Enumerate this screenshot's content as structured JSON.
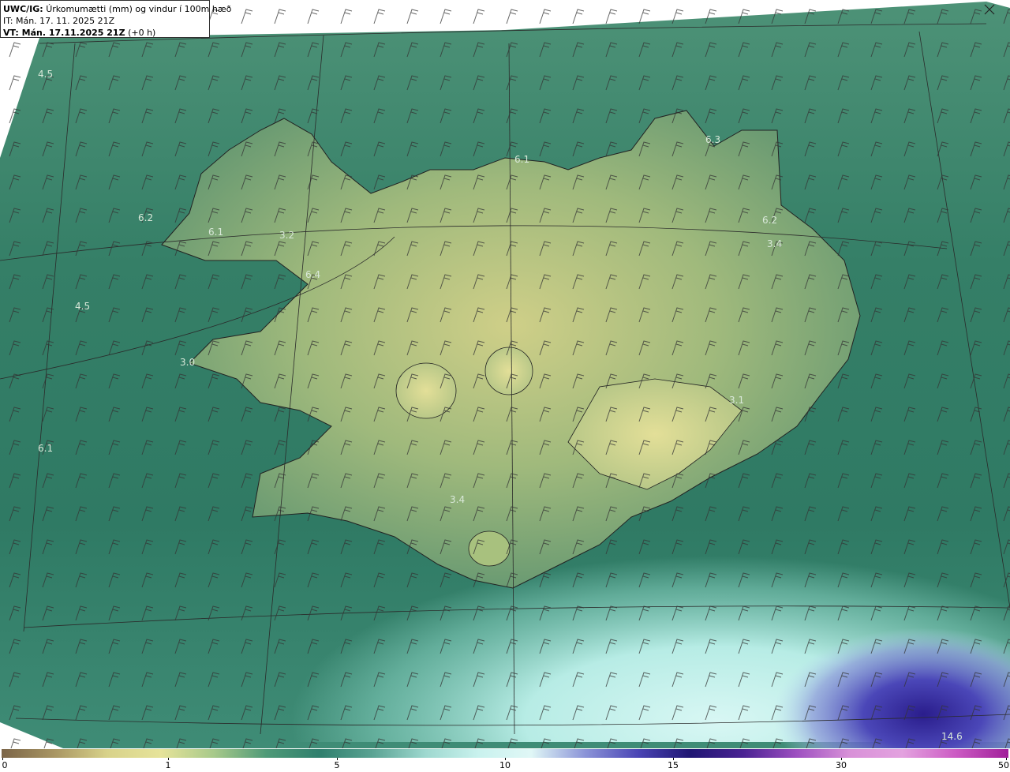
{
  "header": {
    "model": "UWC/IG:",
    "title": "Úrkomumætti (mm) og vindur í 100m hæð",
    "it_label": "IT:",
    "it_value": "Mán. 17. 11. 2025 21Z",
    "vt_label": "VT: Mán. 17.11.2025 21Z",
    "vt_offset": "(+0 h)"
  },
  "labels": [
    {
      "text": "4.5"
    },
    {
      "text": "6.2"
    },
    {
      "text": "6.1"
    },
    {
      "text": "3.2"
    },
    {
      "text": "6.4"
    },
    {
      "text": "4.5"
    },
    {
      "text": "3.0"
    },
    {
      "text": "6.1"
    },
    {
      "text": "6.1"
    },
    {
      "text": "6.3"
    },
    {
      "text": "6.2"
    },
    {
      "text": "3.4"
    },
    {
      "text": "3.1"
    },
    {
      "text": "3.4"
    },
    {
      "text": "14.6"
    }
  ],
  "colorbar": {
    "ticks": [
      "0",
      "1",
      "5",
      "10",
      "15",
      "30",
      "50"
    ],
    "colors": [
      "#7b6548",
      "#a99663",
      "#d8d28a",
      "#e6e39a",
      "#a7c98a",
      "#4f9a78",
      "#2f7f6d",
      "#5aa393",
      "#9ed8cf",
      "#c9f2ee",
      "#e0f7f6",
      "#8c95d8",
      "#4a45b5",
      "#1f1673",
      "#4a2393",
      "#9c4fc0",
      "#d891d8",
      "#e3a2df",
      "#cc5cc4",
      "#a1209a"
    ]
  },
  "colors": {
    "sea": "#3d8a70",
    "land_low": "#6f9e6e",
    "land_high": "#d6d68a",
    "shallow_south": "#bff0ea",
    "deep_precip": "#3a35a8"
  },
  "icons": {
    "close": "close-x-icon",
    "barb": "wind-barb-icon"
  }
}
